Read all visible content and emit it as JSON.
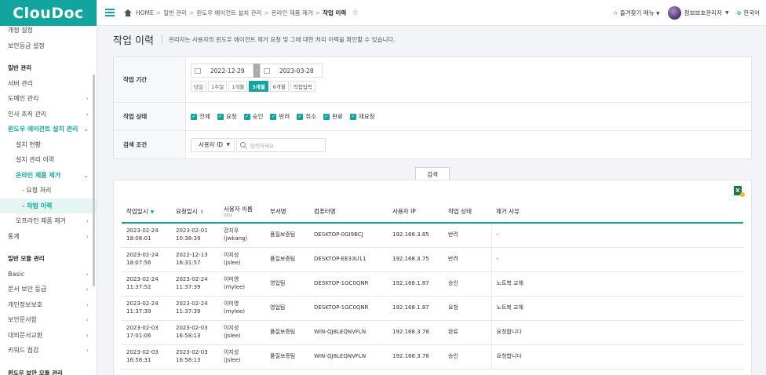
{
  "logo": "ClouDoc",
  "sidebar": {
    "items": [
      {
        "label": "개정 설정",
        "type": "item"
      },
      {
        "label": "보안등급 설정",
        "type": "item"
      },
      {
        "label": "일반 관리",
        "type": "section"
      },
      {
        "label": "서버 관리",
        "type": "item"
      },
      {
        "label": "도메인 관리",
        "type": "item",
        "chevron": "›"
      },
      {
        "label": "인사 조직 관리",
        "type": "item",
        "chevron": "›"
      },
      {
        "label": "윈도우 에이전트 설치 관리",
        "type": "active",
        "chevron": "⌄"
      },
      {
        "label": "설치 현황",
        "type": "sub"
      },
      {
        "label": "설치 관리 이력",
        "type": "sub"
      },
      {
        "label": "온라인 제품 제거",
        "type": "sub-active",
        "chevron": "⌄"
      },
      {
        "label": "- 요청 처리",
        "type": "sub2"
      },
      {
        "label": "- 작업 이력",
        "type": "sub2-selected"
      },
      {
        "label": "오프라인 제품 제거",
        "type": "sub",
        "chevron": "›"
      },
      {
        "label": "통계",
        "type": "item",
        "chevron": "›"
      },
      {
        "label": "일반 모듈 관리",
        "type": "section"
      },
      {
        "label": "Basic",
        "type": "item",
        "chevron": "›"
      },
      {
        "label": "문서 보안 등급",
        "type": "item",
        "chevron": "›"
      },
      {
        "label": "개인정보보호",
        "type": "item",
        "chevron": "›"
      },
      {
        "label": "보안문서함",
        "type": "item",
        "chevron": "›"
      },
      {
        "label": "대외문서교환",
        "type": "item",
        "chevron": "›"
      },
      {
        "label": "키워드 점검",
        "type": "item",
        "chevron": "›"
      },
      {
        "label": "윈도우 보안 모듈 관리",
        "type": "section"
      }
    ]
  },
  "topbar": {
    "breadcrumb": [
      "HOME",
      "일반 관리",
      "윈도우 에이전트 설치 관리",
      "온라인 제품 제거",
      "작업 이력"
    ],
    "favorites": "즐겨찾기 메뉴",
    "user": "정보보호관리자",
    "language": "한국어"
  },
  "page": {
    "title": "작업 이력",
    "description": "관리자는 사용자의 윈도우 에이전트 제거 요청 및 그에 대한 처리 이력을 확인할 수 있습니다."
  },
  "filter": {
    "period_label": "작업 기간",
    "date_from": "2022-12-29",
    "date_to": "2023-03-28",
    "date_sep": "-",
    "period_buttons": [
      {
        "label": "당일",
        "active": false
      },
      {
        "label": "1주일",
        "active": false
      },
      {
        "label": "1개월",
        "active": false
      },
      {
        "label": "3개월",
        "active": true
      },
      {
        "label": "6개월",
        "active": false
      },
      {
        "label": "직접입력",
        "active": false
      }
    ],
    "status_label": "작업 상태",
    "statuses": [
      "전체",
      "요청",
      "승인",
      "반려",
      "취소",
      "완료",
      "재요청"
    ],
    "condition_label": "검색 조건",
    "condition_select": "사용자 ID",
    "search_placeholder": "입력하세요",
    "search_button": "검색"
  },
  "table": {
    "columns": [
      {
        "label": "작업일시",
        "sort": "down"
      },
      {
        "label": "요청일시",
        "sort": "both"
      },
      {
        "label": "사용자 이름",
        "sub": "(ID)"
      },
      {
        "label": "부서명"
      },
      {
        "label": "컴퓨터명"
      },
      {
        "label": "사용자 IP"
      },
      {
        "label": "작업 상태"
      },
      {
        "label": "제거 사유"
      }
    ],
    "rows": [
      {
        "work_date": "2023-02-24",
        "work_time": "18:08:01",
        "req_date": "2023-02-01",
        "req_time": "10:38:39",
        "name": "강지우",
        "id": "(jwkang)",
        "dept": "품질보증팀",
        "pc": "DESKTOP-0GI9BCJ",
        "ip": "192.168.3.85",
        "status": "반려",
        "reason": "-"
      },
      {
        "work_date": "2023-02-24",
        "work_time": "18:07:56",
        "req_date": "2022-12-13",
        "req_time": "16:31:57",
        "name": "이지성",
        "id": "(jslee)",
        "dept": "품질보증팀",
        "pc": "DESKTOP-EE33U11",
        "ip": "192.168.3.75",
        "status": "반려",
        "reason": "-"
      },
      {
        "work_date": "2023-02-24",
        "work_time": "11:37:52",
        "req_date": "2023-02-24",
        "req_time": "11:37:39",
        "name": "이미영",
        "id": "(mylee)",
        "dept": "영업팀",
        "pc": "DESKTOP-1GC0QNR",
        "ip": "192.168.1.87",
        "status": "승인",
        "reason": "노트북 교체"
      },
      {
        "work_date": "2023-02-24",
        "work_time": "11:37:39",
        "req_date": "2023-02-24",
        "req_time": "11:37:39",
        "name": "이미영",
        "id": "(mylee)",
        "dept": "영업팀",
        "pc": "DESKTOP-1GC0QNR",
        "ip": "192.168.1.87",
        "status": "요청",
        "reason": "노트북 교체"
      },
      {
        "work_date": "2023-02-03",
        "work_time": "17:01:06",
        "req_date": "2023-02-03",
        "req_time": "16:58:13",
        "name": "이지성",
        "id": "(jslee)",
        "dept": "품질보증팀",
        "pc": "WIN-QJ8LEQNVFLN",
        "ip": "192.168.3.78",
        "status": "완료",
        "reason": "요청합니다"
      },
      {
        "work_date": "2023-02-03",
        "work_time": "16:58:31",
        "req_date": "2023-02-03",
        "req_time": "16:58:13",
        "name": "이지성",
        "id": "(jslee)",
        "dept": "품질보증팀",
        "pc": "WIN-QJ8LEQNVFLN",
        "ip": "192.168.3.78",
        "status": "승인",
        "reason": "요청합니다"
      }
    ]
  },
  "colors": {
    "accent": "#12a5a0",
    "excel": "#1d7a45"
  }
}
